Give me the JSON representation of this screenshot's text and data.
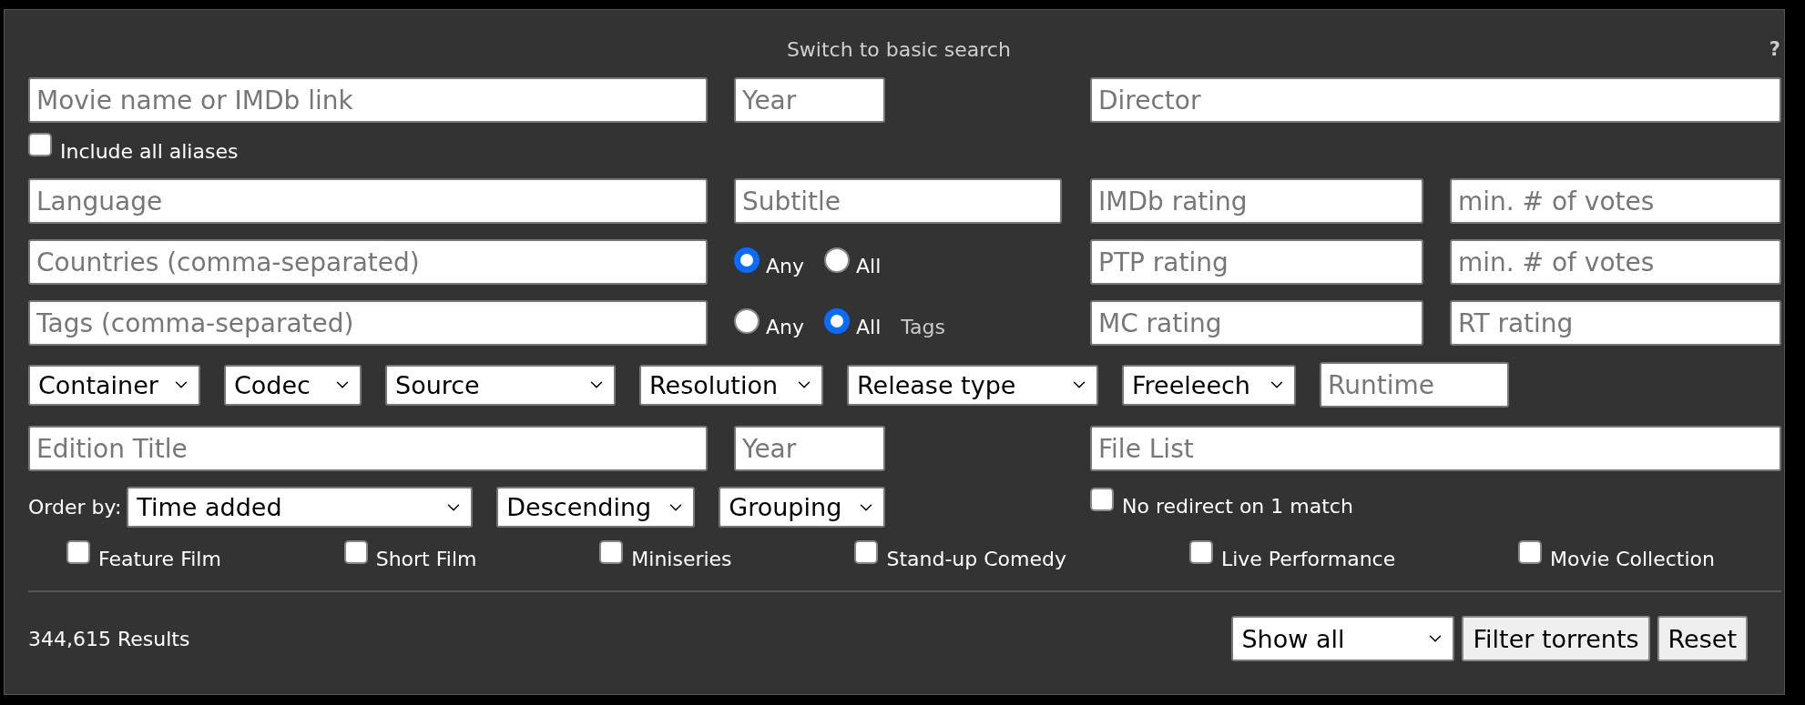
{
  "switch_link": "Switch to basic search",
  "help_link": "?",
  "movie": {
    "placeholder": "Movie name or IMDb link"
  },
  "year": {
    "placeholder": "Year"
  },
  "director": {
    "placeholder": "Director"
  },
  "aliases": {
    "label": "Include all aliases",
    "checked": false
  },
  "language": {
    "placeholder": "Language"
  },
  "subtitle": {
    "placeholder": "Subtitle"
  },
  "imdb_rating": {
    "placeholder": "IMDb rating"
  },
  "imdb_votes": {
    "placeholder": "min. # of votes"
  },
  "countries": {
    "placeholder": "Countries (comma-separated)",
    "match": [
      {
        "label": "Any",
        "selected": true
      },
      {
        "label": "All",
        "selected": false
      }
    ]
  },
  "ptp_rating": {
    "placeholder": "PTP rating"
  },
  "ptp_votes": {
    "placeholder": "min. # of votes"
  },
  "tags": {
    "placeholder": "Tags (comma-separated)",
    "match": [
      {
        "label": "Any",
        "selected": false
      },
      {
        "label": "All",
        "selected": true
      }
    ],
    "suffix": "Tags"
  },
  "mc_rating": {
    "placeholder": "MC rating"
  },
  "rt_rating": {
    "placeholder": "RT rating"
  },
  "filters": [
    {
      "kind": "select",
      "value": "Container"
    },
    {
      "kind": "select",
      "value": "Codec"
    },
    {
      "kind": "select",
      "value": "Source"
    },
    {
      "kind": "select",
      "value": "Resolution"
    },
    {
      "kind": "select",
      "value": "Release type"
    },
    {
      "kind": "select",
      "value": "Freeleech"
    },
    {
      "kind": "input",
      "placeholder": "Runtime"
    }
  ],
  "edition_title": {
    "placeholder": "Edition Title"
  },
  "edition_year": {
    "placeholder": "Year"
  },
  "file_list": {
    "placeholder": "File List"
  },
  "order": {
    "label": "Order by:",
    "selects": [
      "Time added",
      "Descending",
      "Grouping"
    ]
  },
  "no_redirect": {
    "label": "No redirect on 1 match",
    "checked": false
  },
  "release_types": [
    {
      "label": "Feature Film",
      "checked": false
    },
    {
      "label": "Short Film",
      "checked": false
    },
    {
      "label": "Miniseries",
      "checked": false
    },
    {
      "label": "Stand-up Comedy",
      "checked": false
    },
    {
      "label": "Live Performance",
      "checked": false
    },
    {
      "label": "Movie Collection",
      "checked": false
    }
  ],
  "results": "344,615 Results",
  "show": "Show all",
  "buttons": [
    "Filter torrents",
    "Reset"
  ]
}
